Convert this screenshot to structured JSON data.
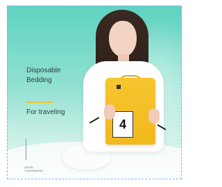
{
  "banner": {
    "product_line1": "Disposable",
    "product_line2": "Bedding",
    "tagline": "For traveling",
    "footer_line1": "GOOD",
    "footer_line2": "TOUGHNESS",
    "package_number": "4"
  },
  "colors": {
    "background_top": "#5fd3c0",
    "accent_line": "#f2c033",
    "package": "#f2b81c",
    "frame_border": "#7ab3ff"
  }
}
